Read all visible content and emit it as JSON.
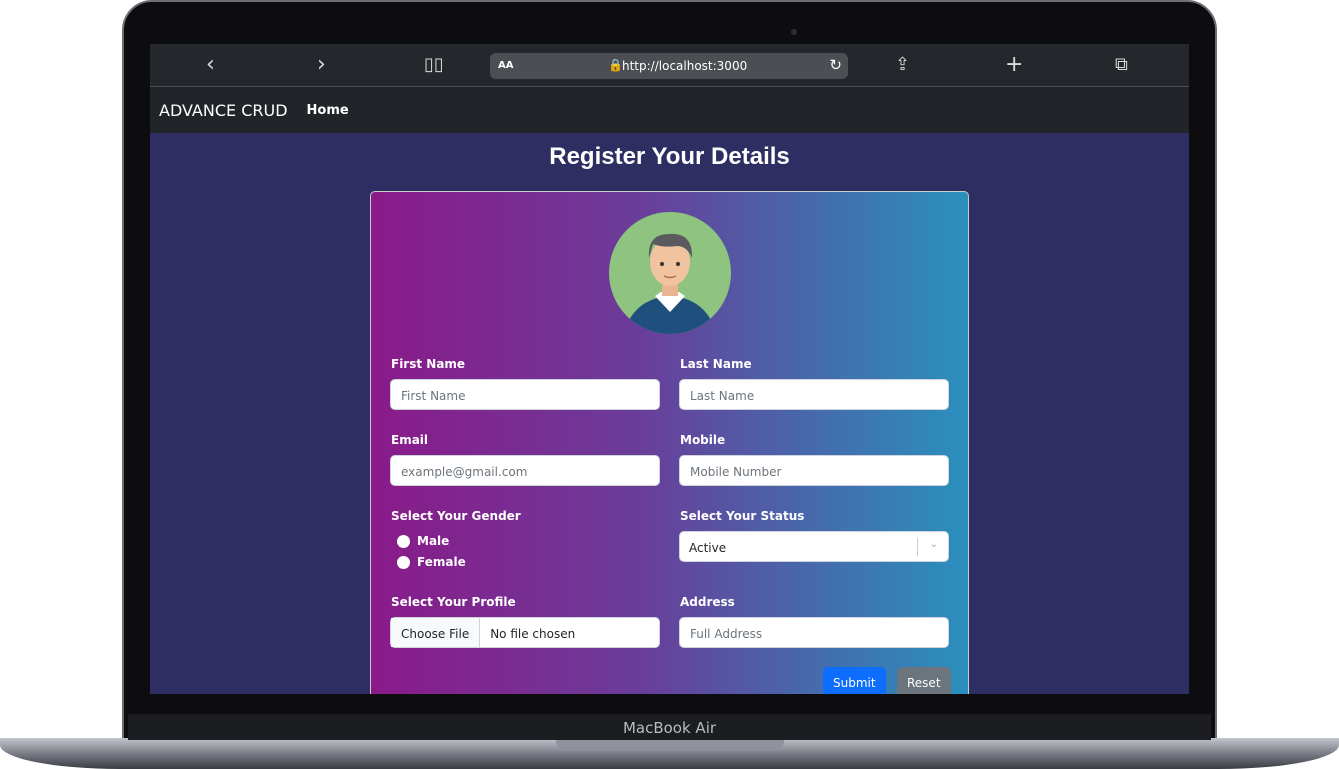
{
  "device": {
    "label": "MacBook Air"
  },
  "browser": {
    "url": "http://localhost:3000",
    "text_size": "AA"
  },
  "navbar": {
    "brand": "ADVANCE CRUD",
    "home": "Home"
  },
  "page": {
    "title": "Register Your Details"
  },
  "form": {
    "first_name": {
      "label": "First Name",
      "placeholder": "First Name"
    },
    "last_name": {
      "label": "Last Name",
      "placeholder": "Last Name"
    },
    "email": {
      "label": "Email",
      "placeholder": "example@gmail.com"
    },
    "mobile": {
      "label": "Mobile",
      "placeholder": "Mobile Number"
    },
    "gender": {
      "label": "Select Your Gender",
      "options": [
        "Male",
        "Female"
      ]
    },
    "status": {
      "label": "Select Your Status",
      "value": "Active"
    },
    "profile": {
      "label": "Select Your Profile",
      "button": "Choose File",
      "value": "No file chosen"
    },
    "address": {
      "label": "Address",
      "placeholder": "Full Address"
    },
    "submit": "Submit",
    "reset": "Reset"
  },
  "colors": {
    "submit": "#0d6efd",
    "reset": "#6c757d",
    "page_bg": "#2f2e63"
  }
}
